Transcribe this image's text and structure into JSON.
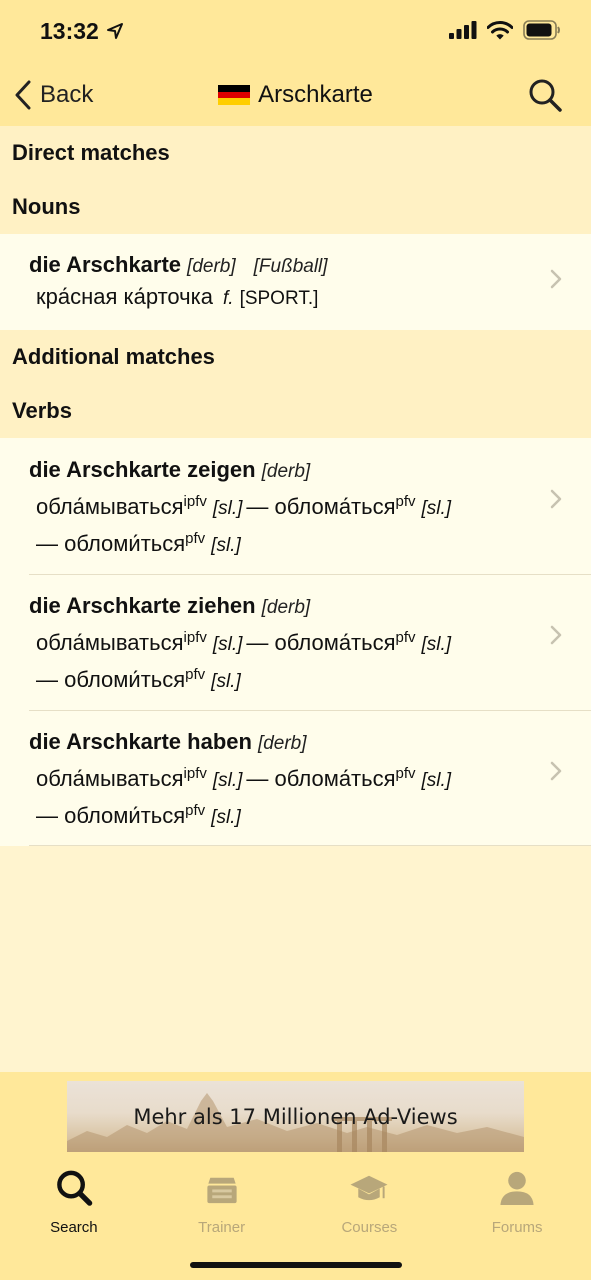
{
  "status_bar": {
    "time": "13:32"
  },
  "nav": {
    "back_label": "Back",
    "title": "Arschkarte",
    "flag_colors": [
      "#000000",
      "#dd0000",
      "#ffce00"
    ]
  },
  "sections": {
    "direct_matches": "Direct matches",
    "nouns": "Nouns",
    "additional_matches": "Additional matches",
    "verbs": "Verbs"
  },
  "nouns": [
    {
      "term": "die Arschkarte",
      "register": "[derb]",
      "domain_tag": "[Fußball]",
      "translation": "кра́сная ка́рточка",
      "gender": "f.",
      "field": "[SPORT.]"
    }
  ],
  "verbs": [
    {
      "term": "die Arschkarte zeigen",
      "register": "[derb]",
      "t1": "обла́мываться",
      "t1_aspect": "ipfv",
      "t1_register": "[sl.]",
      "t2": "— облома́ться",
      "t2_aspect": "pfv",
      "t2_register": "[sl.]",
      "t3": "— обломи́ться",
      "t3_aspect": "pfv",
      "t3_register": "[sl.]"
    },
    {
      "term": "die Arschkarte ziehen",
      "register": "[derb]",
      "t1": "обла́мываться",
      "t1_aspect": "ipfv",
      "t1_register": "[sl.]",
      "t2": "— облома́ться",
      "t2_aspect": "pfv",
      "t2_register": "[sl.]",
      "t3": "— обломи́ться",
      "t3_aspect": "pfv",
      "t3_register": "[sl.]"
    },
    {
      "term": "die Arschkarte haben",
      "register": "[derb]",
      "t1": "обла́мываться",
      "t1_aspect": "ipfv",
      "t1_register": "[sl.]",
      "t2": "— облома́ться",
      "t2_aspect": "pfv",
      "t2_register": "[sl.]",
      "t3": "— обломи́ться",
      "t3_aspect": "pfv",
      "t3_register": "[sl.]"
    }
  ],
  "ad": {
    "text": "Mehr als 17 Millionen Ad-Views"
  },
  "tabs": [
    {
      "label": "Search",
      "icon": "search-icon",
      "active": true
    },
    {
      "label": "Trainer",
      "icon": "card-box-icon",
      "active": false
    },
    {
      "label": "Courses",
      "icon": "graduation-cap-icon",
      "active": false
    },
    {
      "label": "Forums",
      "icon": "person-icon",
      "active": false
    }
  ],
  "colors": {
    "bar_background": "#ffe89a",
    "section_background": "#fff1c4",
    "row_background": "#fffdeb",
    "inactive_tab": "#b8a77a"
  }
}
